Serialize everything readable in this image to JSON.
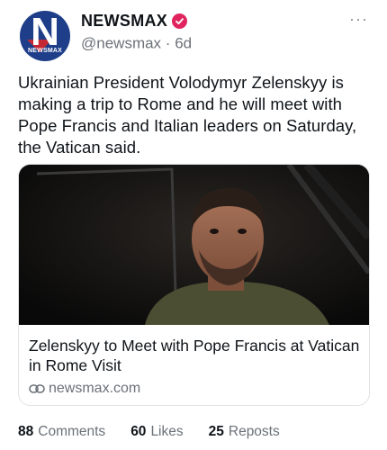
{
  "account": {
    "display_name": "NEWSMAX",
    "handle": "@newsmax",
    "separator": "·",
    "time_ago": "6d",
    "avatar_letter": "N",
    "avatar_small_text": "NEWSMAX",
    "verified_badge_color": "#e0245e",
    "brand_colors": {
      "blue": "#1f3e8a",
      "red": "#d7262b"
    }
  },
  "menu": {
    "more_icon": "more-horizontal-icon",
    "more_glyph": "···"
  },
  "post": {
    "text": "Ukrainian President Volodymyr Zelenskyy is making a trip to Rome and he will meet with Pope Francis and Italian leaders on Saturday, the Vatican said."
  },
  "link_card": {
    "title": "Zelenskyy to Meet with Pope Francis at Vatican in Rome Visit",
    "domain": "newsmax.com",
    "domain_icon": "link-icon"
  },
  "stats": [
    {
      "count": "88",
      "label": "Comments"
    },
    {
      "count": "60",
      "label": "Likes"
    },
    {
      "count": "25",
      "label": "Reposts"
    }
  ]
}
